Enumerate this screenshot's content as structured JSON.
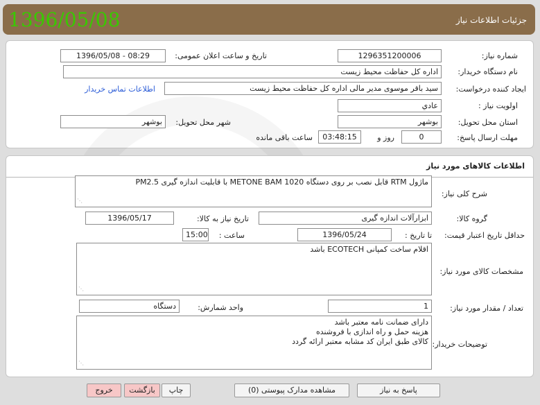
{
  "header": {
    "title": "جزئیات اطلاعات نیاز",
    "date": "1396/05/08"
  },
  "info": {
    "need_number_label": "شماره نیاز:",
    "need_number": "1296351200006",
    "announce_label": "تاریخ و ساعت اعلان عمومی:",
    "announce_value": "1396/05/08 - 08:29",
    "buyer_org_label": "نام دستگاه خریدار:",
    "buyer_org": "اداره کل حفاظت محیط زیست",
    "creator_label": "ایجاد کننده درخواست:",
    "creator": "سید باقر موسوی مدیر مالی اداره کل حفاظت محیط زیست",
    "contact_link": "اطلاعات تماس خریدار",
    "priority_label": "اولویت نیاز :",
    "priority": "عادي",
    "province_label": "استان محل تحویل:",
    "province": "بوشهر",
    "city_label": "شهر محل تحویل:",
    "city": "بوشهر",
    "deadline_label": "مهلت ارسال پاسخ:",
    "days": "0",
    "days_unit": "روز و",
    "time_left": "03:48:15",
    "time_left_unit": "ساعت باقی مانده"
  },
  "goods": {
    "section_title": "اطلاعات کالاهای مورد نیاز",
    "general_desc_label": "شرح کلی نیاز:",
    "general_desc": "ماژول RTM   قابل نصب بر روی دستگاه METONE BAM 1020  با قابلیت اندازه گیری PM2.5",
    "group_label": "گروه کالا:",
    "group": "ابزارآلات اندازه گیری",
    "need_date_label": "تاریخ نیاز به کالا:",
    "need_date": "1396/05/17",
    "min_price_label": "حداقل تاریخ اعتبار قیمت:",
    "until_date_label": "تا تاریخ :",
    "until_date": "1396/05/24",
    "hour_label": "ساعت :",
    "hour": "15:00",
    "specs_label": "مشخصات کالای مورد نیاز:",
    "specs": "اقلام ساخت کمپانی ECOTECH باشد",
    "qty_label": "تعداد / مقدار مورد نیاز:",
    "qty": "1",
    "unit_label": "واحد شمارش:",
    "unit": "دستگاه",
    "buyer_notes_label": "توضیحات خریدار:",
    "buyer_notes": [
      "دارای ضمانت نامه معتبر باشد",
      "هزینه حمل و راه اندازی با فروشنده",
      "کالای طبق ایران کد مشابه معتبر ارائه گردد"
    ]
  },
  "buttons": {
    "reply": "پاسخ به نیاز",
    "attachments": "مشاهده مدارک پیوستی (0)",
    "print": "چاپ",
    "back": "بازگشت",
    "exit": "خروج"
  }
}
